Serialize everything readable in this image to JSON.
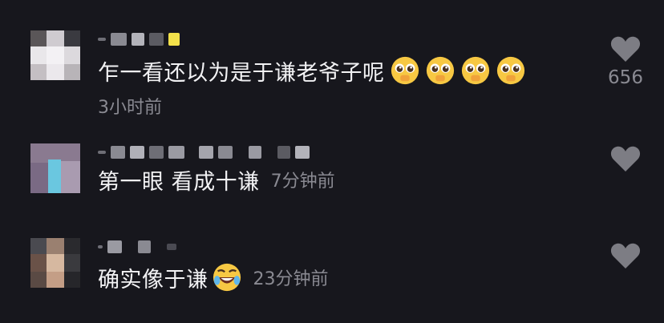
{
  "comments": [
    {
      "text": "乍一看还以为是于谦老爷子呢",
      "time": "3小时前",
      "emojis": [
        "pleading-face-emoji",
        "pleading-face-emoji",
        "pleading-face-emoji",
        "pleading-face-emoji"
      ],
      "like_count": "656"
    },
    {
      "text": "第一眼 看成十谦",
      "time": "7分钟前",
      "emojis": [],
      "like_count": ""
    },
    {
      "text": "确实像于谦",
      "time": "23分钟前",
      "emojis": [
        "rolling-laughing-emoji"
      ],
      "like_count": ""
    }
  ],
  "colors": {
    "background": "#17171d",
    "text": "#f2f2f4",
    "secondary": "#8a8a92",
    "heart": "#7d7d84"
  }
}
